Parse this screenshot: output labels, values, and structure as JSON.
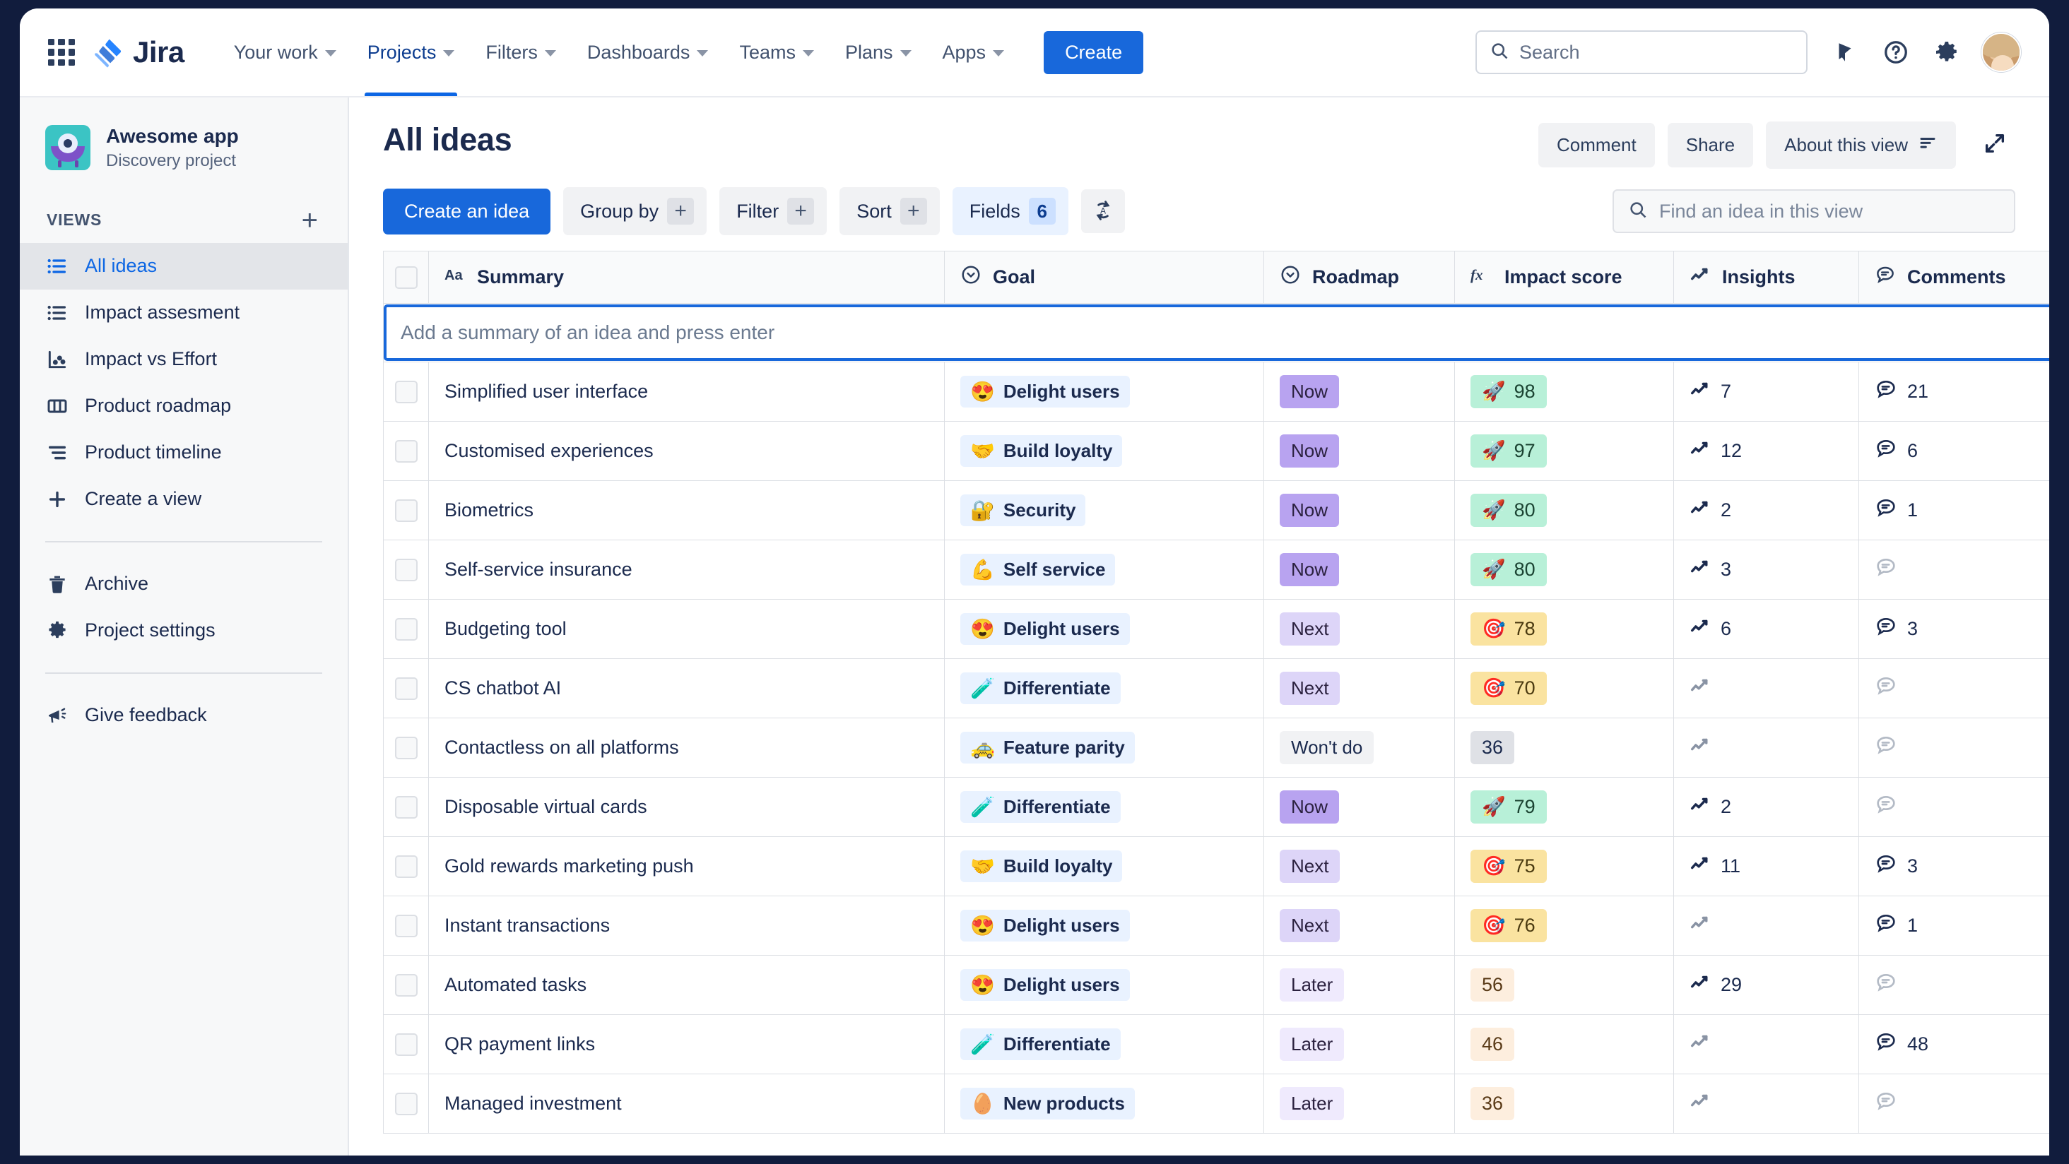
{
  "topnav": {
    "app_switcher": "app-switcher",
    "product": "Jira",
    "items": [
      {
        "label": "Your work",
        "active": false
      },
      {
        "label": "Projects",
        "active": true
      },
      {
        "label": "Filters",
        "active": false
      },
      {
        "label": "Dashboards",
        "active": false
      },
      {
        "label": "Teams",
        "active": false
      },
      {
        "label": "Plans",
        "active": false
      },
      {
        "label": "Apps",
        "active": false
      }
    ],
    "create_label": "Create",
    "search_placeholder": "Search",
    "search_value": "",
    "icons": [
      "notifications-icon",
      "help-icon",
      "settings-icon",
      "avatar"
    ]
  },
  "sidebar": {
    "project_name": "Awesome app",
    "project_type": "Discovery project",
    "views_label": "VIEWS",
    "add_view_label": "+",
    "items": [
      {
        "label": "All ideas",
        "icon": "list-view-icon",
        "selected": true
      },
      {
        "label": "Impact assesment",
        "icon": "list-view-icon",
        "selected": false
      },
      {
        "label": "Impact vs Effort",
        "icon": "scatter-chart-icon",
        "selected": false
      },
      {
        "label": "Product roadmap",
        "icon": "board-columns-icon",
        "selected": false
      },
      {
        "label": "Product timeline",
        "icon": "timeline-icon",
        "selected": false
      },
      {
        "label": "Create a view",
        "icon": "plus-icon",
        "selected": false
      }
    ],
    "secondary_items": [
      {
        "label": "Archive",
        "icon": "trash-icon"
      },
      {
        "label": "Project settings",
        "icon": "gear-icon"
      }
    ],
    "feedback_items": [
      {
        "label": "Give feedback",
        "icon": "megaphone-icon"
      }
    ]
  },
  "main": {
    "title": "All ideas",
    "head_actions": [
      {
        "label": "Comment",
        "name": "comment-button"
      },
      {
        "label": "Share",
        "name": "share-button"
      },
      {
        "label": "About this view",
        "name": "about-this-view-button"
      }
    ],
    "expand_icon": "expand-icon",
    "toolbar": {
      "create_idea_label": "Create an idea",
      "group_by_label": "Group by",
      "filter_label": "Filter",
      "sort_label": "Sort",
      "fields_label": "Fields",
      "fields_count": "6",
      "plus_glyph": "+",
      "autosort_icon": "auto-sort-icon",
      "find_placeholder": "Find an idea in this view",
      "find_value": ""
    }
  },
  "table": {
    "new_idea_placeholder": "Add a summary of an idea and press enter",
    "new_idea_value": "",
    "add_column_glyph": "+",
    "columns": [
      {
        "label": "Summary",
        "icon": "text-field-icon",
        "key": "summary"
      },
      {
        "label": "Goal",
        "icon": "select-field-icon",
        "key": "goal"
      },
      {
        "label": "Roadmap",
        "icon": "select-field-icon",
        "key": "roadmap"
      },
      {
        "label": "Impact score",
        "icon": "formula-icon",
        "key": "impact"
      },
      {
        "label": "Insights",
        "icon": "insights-icon",
        "key": "insights"
      },
      {
        "label": "Comments",
        "icon": "comments-icon",
        "key": "comments"
      }
    ],
    "rows": [
      {
        "summary": "Simplified user interface",
        "goal": "Delight users",
        "goal_emoji": "😍",
        "roadmap": "Now",
        "roadmap_style": "now",
        "impact": "98",
        "impact_emoji": "🚀",
        "impact_style": "green",
        "insights": "7",
        "comments": "21"
      },
      {
        "summary": "Customised experiences",
        "goal": "Build loyalty",
        "goal_emoji": "🤝",
        "roadmap": "Now",
        "roadmap_style": "now",
        "impact": "97",
        "impact_emoji": "🚀",
        "impact_style": "green",
        "insights": "12",
        "comments": "6"
      },
      {
        "summary": "Biometrics",
        "goal": "Security",
        "goal_emoji": "🔐",
        "roadmap": "Now",
        "roadmap_style": "now",
        "impact": "80",
        "impact_emoji": "🚀",
        "impact_style": "green",
        "insights": "2",
        "comments": "1"
      },
      {
        "summary": "Self-service insurance",
        "goal": "Self service",
        "goal_emoji": "💪",
        "roadmap": "Now",
        "roadmap_style": "now",
        "impact": "80",
        "impact_emoji": "🚀",
        "impact_style": "green",
        "insights": "3",
        "comments": ""
      },
      {
        "summary": "Budgeting tool",
        "goal": "Delight users",
        "goal_emoji": "😍",
        "roadmap": "Next",
        "roadmap_style": "next",
        "impact": "78",
        "impact_emoji": "🎯",
        "impact_style": "yellow",
        "insights": "6",
        "comments": "3"
      },
      {
        "summary": "CS chatbot AI",
        "goal": "Differentiate",
        "goal_emoji": "🧪",
        "roadmap": "Next",
        "roadmap_style": "next",
        "impact": "70",
        "impact_emoji": "🎯",
        "impact_style": "yellow",
        "insights": "",
        "comments": ""
      },
      {
        "summary": "Contactless on all platforms",
        "goal": "Feature parity",
        "goal_emoji": "🚕",
        "roadmap": "Won't do",
        "roadmap_style": "wont",
        "impact": "36",
        "impact_emoji": "",
        "impact_style": "gray",
        "insights": "",
        "comments": ""
      },
      {
        "summary": "Disposable virtual cards",
        "goal": "Differentiate",
        "goal_emoji": "🧪",
        "roadmap": "Now",
        "roadmap_style": "now",
        "impact": "79",
        "impact_emoji": "🚀",
        "impact_style": "green",
        "insights": "2",
        "comments": ""
      },
      {
        "summary": "Gold rewards marketing push",
        "goal": "Build loyalty",
        "goal_emoji": "🤝",
        "roadmap": "Next",
        "roadmap_style": "next",
        "impact": "75",
        "impact_emoji": "🎯",
        "impact_style": "yellow",
        "insights": "11",
        "comments": "3"
      },
      {
        "summary": "Instant transactions",
        "goal": "Delight users",
        "goal_emoji": "😍",
        "roadmap": "Next",
        "roadmap_style": "next",
        "impact": "76",
        "impact_emoji": "🎯",
        "impact_style": "yellow",
        "insights": "",
        "comments": "1"
      },
      {
        "summary": "Automated tasks",
        "goal": "Delight users",
        "goal_emoji": "😍",
        "roadmap": "Later",
        "roadmap_style": "later",
        "impact": "56",
        "impact_emoji": "",
        "impact_style": "peach",
        "insights": "29",
        "comments": ""
      },
      {
        "summary": "QR payment links",
        "goal": "Differentiate",
        "goal_emoji": "🧪",
        "roadmap": "Later",
        "roadmap_style": "later",
        "impact": "46",
        "impact_emoji": "",
        "impact_style": "peach",
        "insights": "",
        "comments": "48"
      },
      {
        "summary": "Managed investment",
        "goal": "New products",
        "goal_emoji": "🥚",
        "roadmap": "Later",
        "roadmap_style": "later",
        "impact": "36",
        "impact_emoji": "",
        "impact_style": "peach",
        "insights": "",
        "comments": ""
      }
    ]
  },
  "colors": {
    "brand_blue": "#1868db",
    "nav_active": "#0c66e4",
    "text_dark": "#1b2a4e",
    "roadmap_now": "#b8a3f0",
    "roadmap_next": "#ddd5f8",
    "roadmap_later": "#efeafd",
    "score_green": "#b8f0d8",
    "score_yellow": "#fae3a0",
    "score_peach": "#fdeede"
  }
}
